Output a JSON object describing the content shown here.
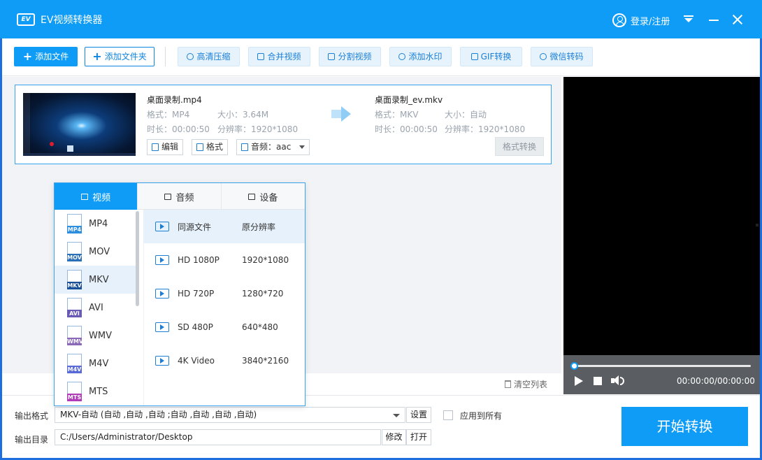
{
  "app": {
    "title": "EV视频转换器",
    "logo": "EV"
  },
  "titlebar": {
    "login": "登录/注册"
  },
  "toolbar": {
    "add_file": "添加文件",
    "add_folder": "添加文件夹",
    "tools": [
      {
        "label": "高清压缩",
        "icon": "compress-icon"
      },
      {
        "label": "合并视频",
        "icon": "merge-icon"
      },
      {
        "label": "分割视频",
        "icon": "split-icon"
      },
      {
        "label": "添加水印",
        "icon": "watermark-icon"
      },
      {
        "label": "GIF转换",
        "icon": "gif-icon"
      },
      {
        "label": "微信转码",
        "icon": "wechat-icon"
      }
    ]
  },
  "file": {
    "source": {
      "name": "桌面录制.mp4",
      "format": "格式：MP4",
      "size": "大小：3.64M",
      "duration": "时长：00:00:50",
      "resolution": "分辨率：1920*1080"
    },
    "target": {
      "name": "桌面录制_ev.mkv",
      "format": "格式：MKV",
      "size": "大小：自动",
      "duration": "时长：00:00:50",
      "resolution": "分辨率：1920*1080"
    },
    "edit": "编辑",
    "format_btn": "格式",
    "audio": "音频：aac",
    "convert_format": "格式转换"
  },
  "clear_list": "清空列表",
  "popup": {
    "tabs": [
      "视频",
      "音频",
      "设备"
    ],
    "active_tab": 0,
    "formats": [
      {
        "label": "MP4",
        "color": "#2e8ee0"
      },
      {
        "label": "MOV",
        "color": "#2a6fb8"
      },
      {
        "label": "MKV",
        "color": "#1a4f9a"
      },
      {
        "label": "AVI",
        "color": "#6a5ab8"
      },
      {
        "label": "WMV",
        "color": "#8a6ab8"
      },
      {
        "label": "M4V",
        "color": "#5a6ad8"
      },
      {
        "label": "MTS",
        "color": "#b03ab8"
      }
    ],
    "selected_format": 2,
    "presets": [
      {
        "name": "同源文件",
        "res": "原分辨率"
      },
      {
        "name": "HD 1080P",
        "res": "1920*1080"
      },
      {
        "name": "HD 720P",
        "res": "1280*720"
      },
      {
        "name": "SD 480P",
        "res": "640*480"
      },
      {
        "name": "4K Video",
        "res": "3840*2160"
      }
    ],
    "selected_preset": 0
  },
  "output": {
    "format_label": "输出格式",
    "format_value": "MKV-自动 (自动 ,自动 ,自动 ;自动 ,自动 ,自动 ,自动)",
    "settings": "设置",
    "apply_all": "应用到所有",
    "dir_label": "输出目录",
    "dir_value": "C:/Users/Administrator/Desktop",
    "modify": "修改",
    "open": "打开"
  },
  "start": "开始转换",
  "player": {
    "time": "00:00:00/00:00:00"
  },
  "colors": {
    "accent": "#0f9cf6",
    "frame": "#1d6fe0"
  }
}
